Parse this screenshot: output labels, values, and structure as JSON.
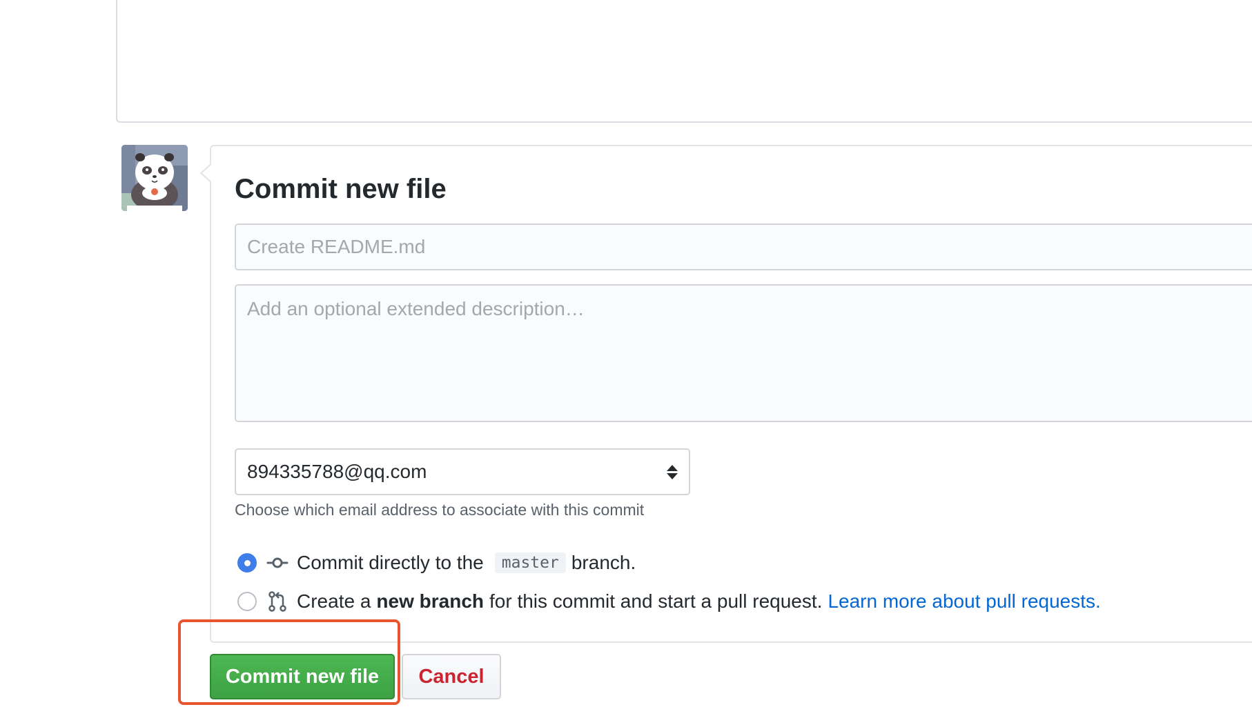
{
  "commit_form": {
    "title": "Commit new file",
    "summary_placeholder": "Create README.md",
    "description_placeholder": "Add an optional extended description…",
    "email": {
      "selected": "894335788@qq.com",
      "note": "Choose which email address to associate with this commit"
    },
    "option_direct": {
      "prefix": "Commit directly to the",
      "branch": "master",
      "suffix": "branch.",
      "selected": true
    },
    "option_new_branch": {
      "prefix": "Create a",
      "bold": "new branch",
      "suffix": "for this commit and start a pull request.",
      "link": "Learn more about pull requests.",
      "selected": false
    },
    "commit_button": "Commit new file",
    "cancel_button": "Cancel"
  },
  "colors": {
    "commit_button": "#3ea244",
    "cancel_text": "#cb2431",
    "link": "#0366d6",
    "radio_selected": "#3f7de8",
    "annotation_box": "#e8542e"
  },
  "icons": {
    "direct_commit": "git-commit-icon",
    "new_branch": "git-pull-request-icon",
    "select_arrows": "select-updown-icon"
  }
}
